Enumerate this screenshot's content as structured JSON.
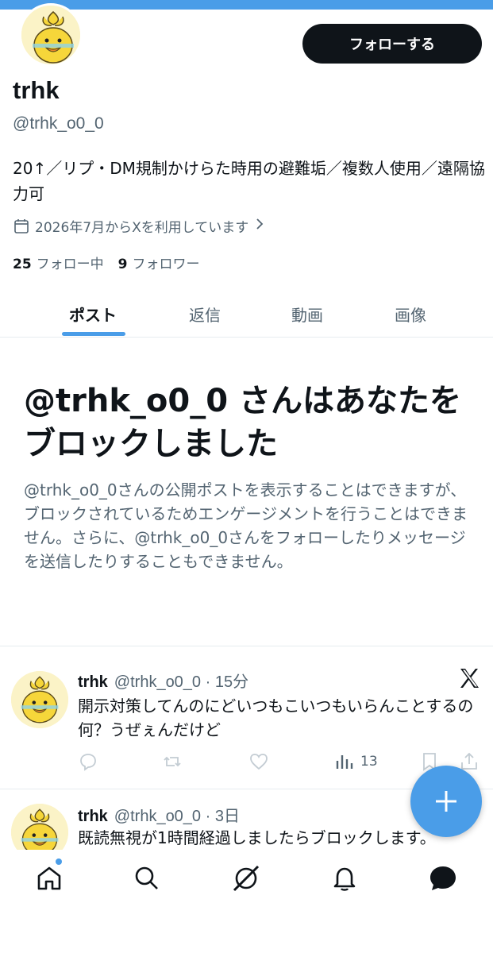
{
  "profile": {
    "name": "trhk",
    "handle": "@trhk_o0_0",
    "follow_label": "フォローする",
    "bio": "20↑／リプ・DM規制かけらた時用の避難垢／複数人使用／遠隔協力可",
    "joined": "2026年7月からXを利用しています",
    "following_count": "25",
    "following_label": "フォロー中",
    "followers_count": "9",
    "followers_label": "フォロワー"
  },
  "tabs": [
    {
      "label": "ポスト",
      "active": true
    },
    {
      "label": "返信",
      "active": false
    },
    {
      "label": "動画",
      "active": false
    },
    {
      "label": "画像",
      "active": false
    }
  ],
  "blocked": {
    "title": "@trhk_o0_0 さんはあなたをブロックしました",
    "description": "@trhk_o0_0さんの公開ポストを表示することはできますが、ブロックされているためエンゲージメントを行うことはできません。さらに、@trhk_o0_0さんをフォローしたりメッセージを送信したりすることもできません。"
  },
  "posts": [
    {
      "name": "trhk",
      "meta": "@trhk_o0_0 · 15分",
      "text": "開示対策してんのにどいつもこいつもいらんことするの何？うぜぇんだけど",
      "views": "13"
    },
    {
      "name": "trhk",
      "meta": "@trhk_o0_0 · 3日",
      "text": "既読無視が1時間経過しましたらブロックします。"
    }
  ],
  "colors": {
    "accent": "#4a9de8",
    "text_primary": "#0f1419",
    "text_secondary": "#536471",
    "divider": "#e6ecf0"
  },
  "icons": {
    "calendar": "calendar-icon",
    "chevron": "chevron-right-icon",
    "x_logo": "x-logo-icon",
    "reply": "reply-icon",
    "repost": "repost-icon",
    "like": "heart-icon",
    "views": "views-icon",
    "bookmark": "bookmark-icon",
    "share": "share-icon",
    "compose": "plus-icon",
    "home": "home-icon",
    "search": "search-icon",
    "grok": "grok-icon",
    "notifications": "bell-icon",
    "messages": "message-icon"
  }
}
